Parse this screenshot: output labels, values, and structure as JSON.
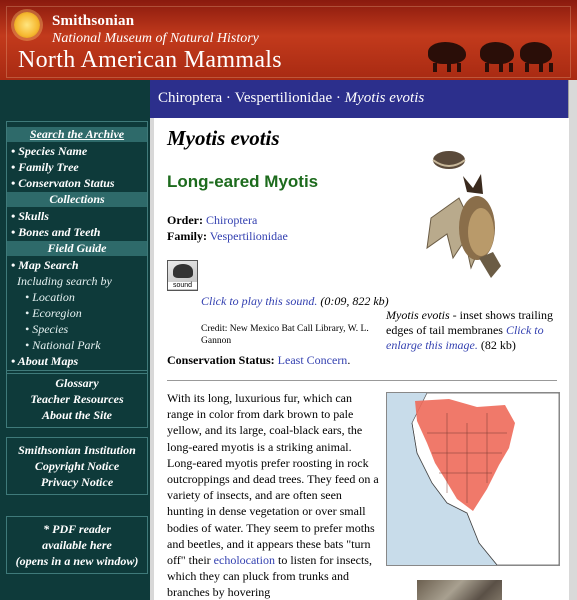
{
  "banner": {
    "institution": "Smithsonian",
    "museum": "National Museum of Natural History",
    "site_title": "North American Mammals"
  },
  "topbar": {
    "order": "Chiroptera",
    "separator": "·",
    "family": "Vespertilionidae",
    "species": "Myotis evotis"
  },
  "nav": {
    "search_archive": "Search the Archive",
    "search_items": [
      "Species Name",
      "Family Tree",
      "Conservaton Status"
    ],
    "collections": "Collections",
    "collection_items": [
      "Skulls",
      "Bones and Teeth"
    ],
    "field_guide": "Field Guide",
    "map_search": "Map Search",
    "including": "Including search by",
    "map_sub": [
      "Location",
      "Ecoregion",
      "Species",
      "National Park"
    ],
    "about_maps": "About Maps",
    "box2": [
      "Glossary",
      "Teacher Resources",
      "About the Site"
    ],
    "box3": [
      "Smithsonian Institution",
      "Copyright Notice",
      "Privacy Notice"
    ],
    "box4": [
      "* PDF reader",
      "available here",
      "(opens in a new window)"
    ]
  },
  "species": {
    "scientific_name": "Myotis evotis",
    "common_name": "Long-eared Myotis",
    "order_label": "Order:",
    "order_value": "Chiroptera",
    "family_label": "Family:",
    "family_value": "Vespertilionidae",
    "sound_label": "sound",
    "play_link": "Click to play this sound.",
    "play_meta": "(0:09, 822 kb)",
    "credit": "Credit: New Mexico Bat Call Library, W. L. Gannon",
    "conservation_label": "Conservation Status:",
    "conservation_value": "Least Concern",
    "conservation_end": "."
  },
  "image_caption": {
    "italic": "Myotis evotis",
    "text": " - inset shows trailing edges of tail membranes",
    "link": "Click to enlarge this image.",
    "meta": "(82 kb)"
  },
  "body": {
    "para_before": "With its long, luxurious fur, which can range in color from dark brown to pale yellow, and its large, coal-black ears, the long-eared myotis is a striking animal. Long-eared myotis prefer roosting in rock outcroppings and dead trees. They feed on a variety of insects, and are often seen hunting in dense vegetation or over small bodies of water. They seem to prefer moths and beetles, and it appears these bats \"turn off\" their ",
    "link": "echolocation",
    "para_after": " to listen for insects, which they can pluck from trunks and branches by hovering"
  },
  "colors": {
    "banner": "#b02e16",
    "nav_bg": "#0e3a3a",
    "topbar": "#2c2f8c",
    "common_name": "#1d6b1d",
    "link": "#3340b0",
    "range": "#f06050"
  },
  "icons": [
    "smithsonian-sun-icon",
    "sound-icon"
  ]
}
